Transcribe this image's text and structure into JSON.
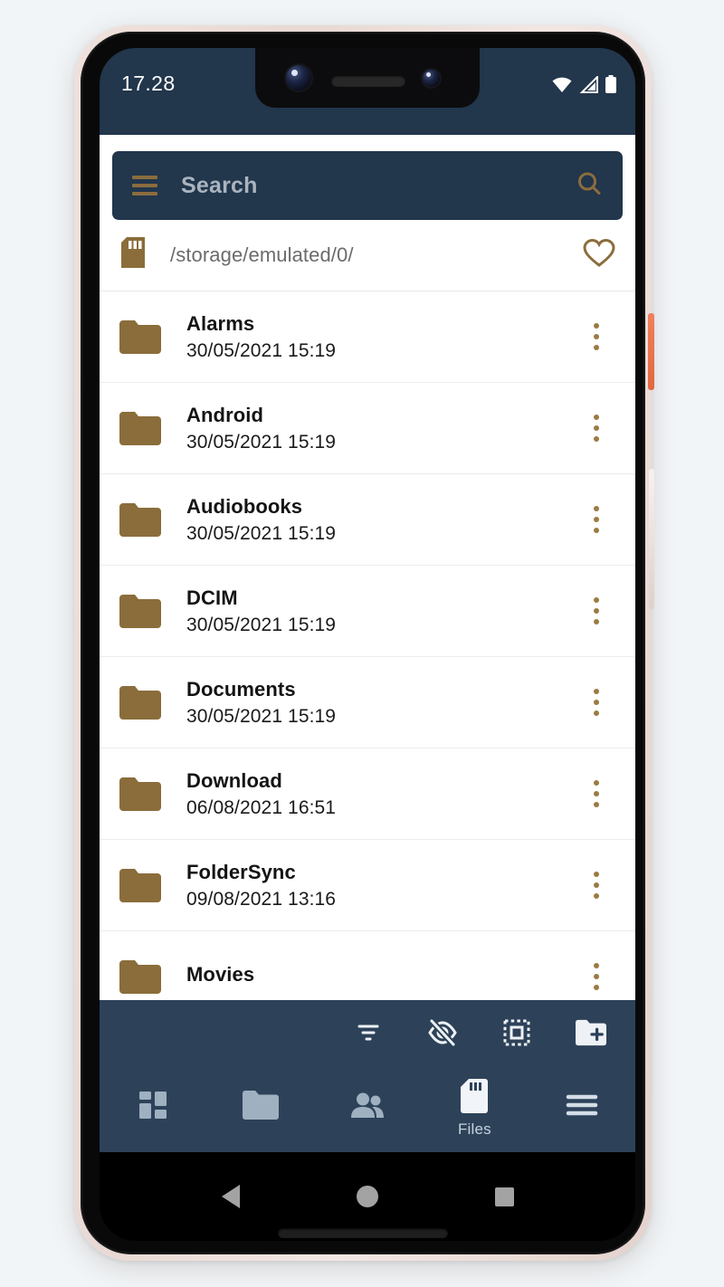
{
  "status_bar": {
    "time": "17.28",
    "icons": [
      "wifi-icon",
      "cellular-signal-icon",
      "battery-icon"
    ]
  },
  "colors": {
    "navy_dark": "#22364c",
    "navy_toolbar": "#2d4259",
    "bronze": "#8b6d3e",
    "folder_bronze": "#8a6d3b",
    "placeholder_grey": "#aab4bf",
    "power_button": "#e2683f",
    "page_background": "#f2f5f7"
  },
  "search": {
    "placeholder": "Search",
    "menu_icon": "hamburger-menu-icon",
    "action_icon": "search-icon"
  },
  "path_bar": {
    "storage_icon": "sd-card-icon",
    "path": "/storage/emulated/0/",
    "favorite_icon": "heart-outline-icon"
  },
  "file_list": {
    "rows": [
      {
        "icon": "folder-icon",
        "name": "Alarms",
        "date": "30/05/2021 15:19",
        "menu_icon": "overflow-menu-icon"
      },
      {
        "icon": "folder-icon",
        "name": "Android",
        "date": "30/05/2021 15:19",
        "menu_icon": "overflow-menu-icon"
      },
      {
        "icon": "folder-icon",
        "name": "Audiobooks",
        "date": "30/05/2021 15:19",
        "menu_icon": "overflow-menu-icon"
      },
      {
        "icon": "folder-icon",
        "name": "DCIM",
        "date": "30/05/2021 15:19",
        "menu_icon": "overflow-menu-icon"
      },
      {
        "icon": "folder-icon",
        "name": "Documents",
        "date": "30/05/2021 15:19",
        "menu_icon": "overflow-menu-icon"
      },
      {
        "icon": "folder-icon",
        "name": "Download",
        "date": "06/08/2021 16:51",
        "menu_icon": "overflow-menu-icon"
      },
      {
        "icon": "folder-icon",
        "name": "FolderSync",
        "date": "09/08/2021 13:16",
        "menu_icon": "overflow-menu-icon"
      },
      {
        "icon": "folder-icon",
        "name": "Movies",
        "date": "",
        "menu_icon": "overflow-menu-icon"
      }
    ]
  },
  "action_toolbar": {
    "buttons": [
      {
        "icon": "sort-filter-icon"
      },
      {
        "icon": "hide-hidden-files-icon"
      },
      {
        "icon": "select-all-icon"
      },
      {
        "icon": "new-folder-icon"
      }
    ]
  },
  "bottom_nav": {
    "items": [
      {
        "icon": "dashboard-grid-icon",
        "label": "",
        "active": false
      },
      {
        "icon": "folder-pairs-icon",
        "label": "",
        "active": false
      },
      {
        "icon": "accounts-people-icon",
        "label": "",
        "active": false
      },
      {
        "icon": "sd-card-icon",
        "label": "Files",
        "active": true
      },
      {
        "icon": "hamburger-menu-icon",
        "label": "",
        "active": false
      }
    ]
  },
  "android_nav": {
    "back": "back-triangle-icon",
    "home": "home-circle-icon",
    "recents": "recents-square-icon"
  }
}
